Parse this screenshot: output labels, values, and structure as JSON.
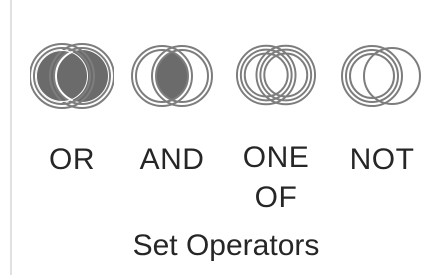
{
  "ribbon_group": {
    "title": "Set Operators",
    "buttons": [
      {
        "id": "or",
        "label": "OR",
        "icon": "venn-union-icon"
      },
      {
        "id": "and",
        "label": "AND",
        "icon": "venn-intersection-icon"
      },
      {
        "id": "one_of",
        "label_line1": "ONE",
        "label_line2": "OF",
        "icon": "venn-exclusive-or-icon"
      },
      {
        "id": "not",
        "label": "NOT",
        "icon": "venn-difference-icon"
      }
    ]
  },
  "colors": {
    "icon_fill": "#6b6b6b",
    "icon_ring": "#7d7d7d",
    "text": "#262626",
    "divider": "#e1e1e1"
  }
}
